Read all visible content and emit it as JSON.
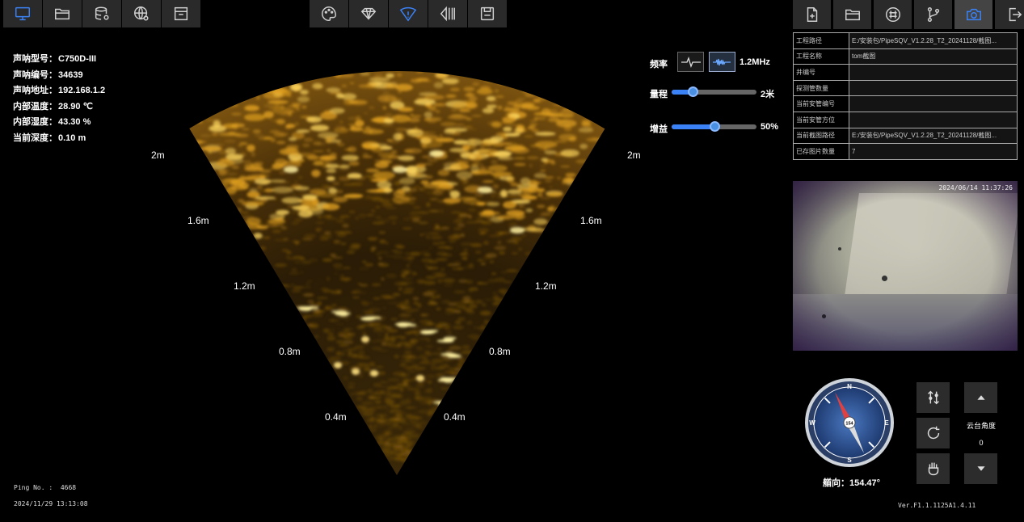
{
  "toolbar_left": [
    {
      "icon": "monitor-icon",
      "active": true
    },
    {
      "icon": "folder-open-icon",
      "active": false
    },
    {
      "icon": "database-settings-icon",
      "active": false
    },
    {
      "icon": "globe-settings-icon",
      "active": false
    },
    {
      "icon": "archive-icon",
      "active": false
    }
  ],
  "toolbar_center": [
    {
      "icon": "palette-icon",
      "active": false
    },
    {
      "icon": "diamond-icon",
      "active": false
    },
    {
      "icon": "sonar-fan-icon",
      "active": true
    },
    {
      "icon": "mirror-icon",
      "active": false
    },
    {
      "icon": "save-icon",
      "active": false
    }
  ],
  "toolbar_right": [
    {
      "icon": "new-file-icon",
      "active": false
    },
    {
      "icon": "open-folder-icon",
      "active": false
    },
    {
      "icon": "grid-icon",
      "active": false
    },
    {
      "icon": "branch-icon",
      "active": false
    },
    {
      "icon": "camera-icon",
      "active": true
    },
    {
      "icon": "export-icon",
      "active": false
    }
  ],
  "device": {
    "model_label": "声呐型号：",
    "model": "C750D-III",
    "serial_label": "声呐编号：",
    "serial": "34639",
    "addr_label": "声呐地址：",
    "addr": "192.168.1.2",
    "temp_label": "内部温度：",
    "temp": "28.90 ℃",
    "humid_label": "内部湿度：",
    "humid": "43.30 %",
    "depth_label": "当前深度：",
    "depth": "0.10 m"
  },
  "range_labels": {
    "r2": "2m",
    "r16": "1.6m",
    "r12": "1.2m",
    "r08": "0.8m",
    "r04": "0.4m"
  },
  "controls": {
    "freq_label": "频率",
    "freq_value": "1.2MHz",
    "range_label": "量程",
    "range_value": "2米",
    "range_level": 0.25,
    "gain_label": "增益",
    "gain_value": "50%",
    "gain_level": 0.5
  },
  "project_table": [
    {
      "key": "工程路径",
      "value": "E:/安装包/PipeSQV_V1.2.28_T2_20241128/截图..."
    },
    {
      "key": "工程名称",
      "value": "tom截图"
    },
    {
      "key": "井编号",
      "value": ""
    },
    {
      "key": "探测管数量",
      "value": ""
    },
    {
      "key": "当前安管编号",
      "value": ""
    },
    {
      "key": "当前安管方位",
      "value": ""
    },
    {
      "key": "当前截图路径",
      "value": "E:/安装包/PipeSQV_V1.2.28_T2_20241128/截图..."
    },
    {
      "key": "已存图片数量",
      "value": "7"
    }
  ],
  "camera": {
    "timestamp": "2024/06/14 11:37:26"
  },
  "compass": {
    "heading_label": "艏向：",
    "heading": "154.47°",
    "center": "154",
    "n": "N",
    "s": "S",
    "e": "E",
    "w": "W",
    "heading_deg": 154.47
  },
  "ptz": {
    "label": "云台角度",
    "value": "0"
  },
  "footer": {
    "ping_label": "Ping No. :",
    "ping": "4668",
    "datetime": "2024/11/29 13:13:08",
    "version": "Ver.F1.1.1125A1.4.11"
  }
}
